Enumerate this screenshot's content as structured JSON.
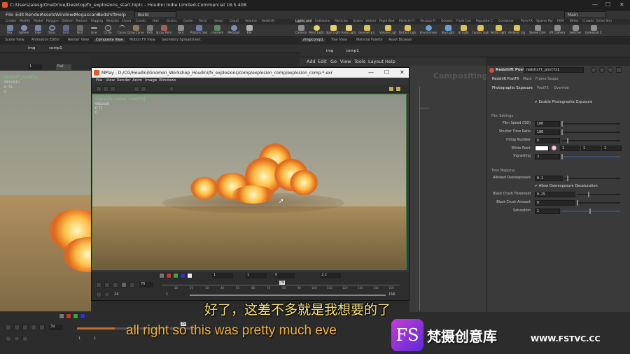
{
  "window": {
    "title": "C:/Users/alesg/OneDrive/Desktop/fx_explosions_start.hiplc - Houdini Indie Limited-Commercial 18.5.408",
    "controls": [
      "—",
      "☐",
      "✕"
    ]
  },
  "menubar": {
    "items": [
      "File",
      "Edit",
      "Render",
      "Assets",
      "Windows",
      "Megascans",
      "Redshift",
      "Help"
    ],
    "desktop_select": "Build",
    "main_select": "Main"
  },
  "shelf": {
    "left_tabs": [
      "Create",
      "Modify",
      "Model",
      "Polygon",
      "Deform",
      "Texture",
      "Rigging",
      "Muscles",
      "Chara",
      "Constr",
      "Hair",
      "Grains",
      "Guide",
      "Terra",
      "Simpl",
      "Cloud",
      "Volume",
      "Redshift"
    ],
    "left_tools": [
      "Box",
      "Sphere",
      "Tube",
      "Torus",
      "Grid",
      "Null",
      "Line",
      "Circle",
      "Curve",
      "Draw Curve",
      "Path",
      "Spray Paint",
      "Font",
      "Platonic Solids",
      "L-System",
      "Metaball",
      "File"
    ],
    "right_tabs": [
      "Lights and",
      "Collisions",
      "Particles",
      "Grains",
      "Vellum",
      "Rigid Bod",
      "Particle Fl",
      "Viscous Fl",
      "Oceans",
      "Fluid Con",
      "Populate C",
      "Container",
      "Pyro FX",
      "Sparse Pyr",
      "FEM",
      "Wires",
      "Crowds",
      "Drive Sim"
    ],
    "right_tools": [
      "Camera",
      "Point Light",
      "Spot Light",
      "Area Light",
      "Geometry Light",
      "Volume Light",
      "Distant Light",
      "Environment Light",
      "Sky Light",
      "GI Light",
      "Caustic Light",
      "Portal Light",
      "Ambient Light",
      "Stereo Camera",
      "VR Camera",
      "Switcher",
      "Gamepad Camera"
    ]
  },
  "left_pane": {
    "tabs": [
      "Scene View",
      "Animation Editor",
      "Render View",
      "Composite View",
      "Motion FX View",
      "Geometry Spreadsheet"
    ],
    "path": [
      "img",
      "comp1"
    ],
    "frame_field": "1",
    "fit_label": "Full",
    "node_name": "redshift_postfx1",
    "res": "960x540",
    "fr": "fr 39",
    "ch": "C"
  },
  "mplay": {
    "title": "MPlay - D:/CG/Houdini/Gnomon_Workshop_Houdini/fx_explosions/comp/explosion_comp/explosion_comp.*.exr",
    "menu": [
      "File",
      "View",
      "Render",
      "Anim",
      "Image",
      "Windows"
    ],
    "overlay_name": "explosion_comp_*.exr[71]",
    "overlay_res": "960x540",
    "overlay_fr": "fr 71",
    "overlay_ch": "C",
    "field_1": "1",
    "field_2": "1",
    "field_3": "0",
    "gamma": "2.2",
    "frame": "76",
    "fps": "24",
    "range_start": "1",
    "range_end": "156",
    "marker": "76",
    "ticks": [
      "10",
      "20",
      "30",
      "40",
      "50",
      "60",
      "70",
      "80",
      "90",
      "100",
      "110",
      "120",
      "130",
      "140",
      "150"
    ]
  },
  "network": {
    "path_tabs": [
      "/img/comp1",
      "Tree View",
      "Material Palette",
      "Asset Browser"
    ],
    "path": [
      "img",
      "comp1"
    ],
    "menu": [
      "Add",
      "Edit",
      "Go",
      "View",
      "Tools",
      "Layout",
      "Help"
    ],
    "watermark": "Compositing"
  },
  "params": {
    "node_type": "Redshift PostFX",
    "node_name": "redshift_postfx1",
    "tabs": [
      "Redshift PostFX",
      "Mask",
      "Frame Scope"
    ],
    "subtabs": [
      "Photographic Exposure",
      "PostFX",
      "Override"
    ],
    "enable_label": "Enable Photographic Exposure",
    "film_section": "Film Settings",
    "film_speed_label": "Film Speed (ISO)",
    "film_speed": "100",
    "shutter_label": "Shutter Time Ratio",
    "shutter": "100",
    "fstop_label": "f-Stop Number",
    "fstop": "8",
    "white_point_label": "White Point",
    "wp_r": "1",
    "wp_g": "1",
    "wp_b": "1",
    "vignetting_label": "Vignetting",
    "vignetting": "3",
    "tone_section": "Tone Mapping",
    "overexp_label": "Allowed Overexposure",
    "overexp": "0.1",
    "allow_desat_label": "Allow Overexposure Desaturation",
    "black_thresh_label": "Black Crush Threshold",
    "black_thresh": "0.25",
    "black_amount_label": "Black Crush Amount",
    "black_amount": "0",
    "saturation_label": "Saturation",
    "saturation": "1"
  },
  "timeline": {
    "frame": "39",
    "marker": "39",
    "start": "1",
    "start2": "1",
    "end_field": "1"
  },
  "subtitles": {
    "chinese": "好了，这差不多就是我想要的了",
    "english": "all right so this was pretty much eve"
  },
  "watermark": {
    "logo": "FS",
    "name": "梵摄创意库",
    "url": "WWW.FSTVC.CC"
  },
  "colors": {
    "accent_green": "#3f7a3f",
    "subtitle_yellow": "#f6e07a",
    "subtitle_orange": "#f0b040",
    "logo_purple": "#8a35d6"
  }
}
